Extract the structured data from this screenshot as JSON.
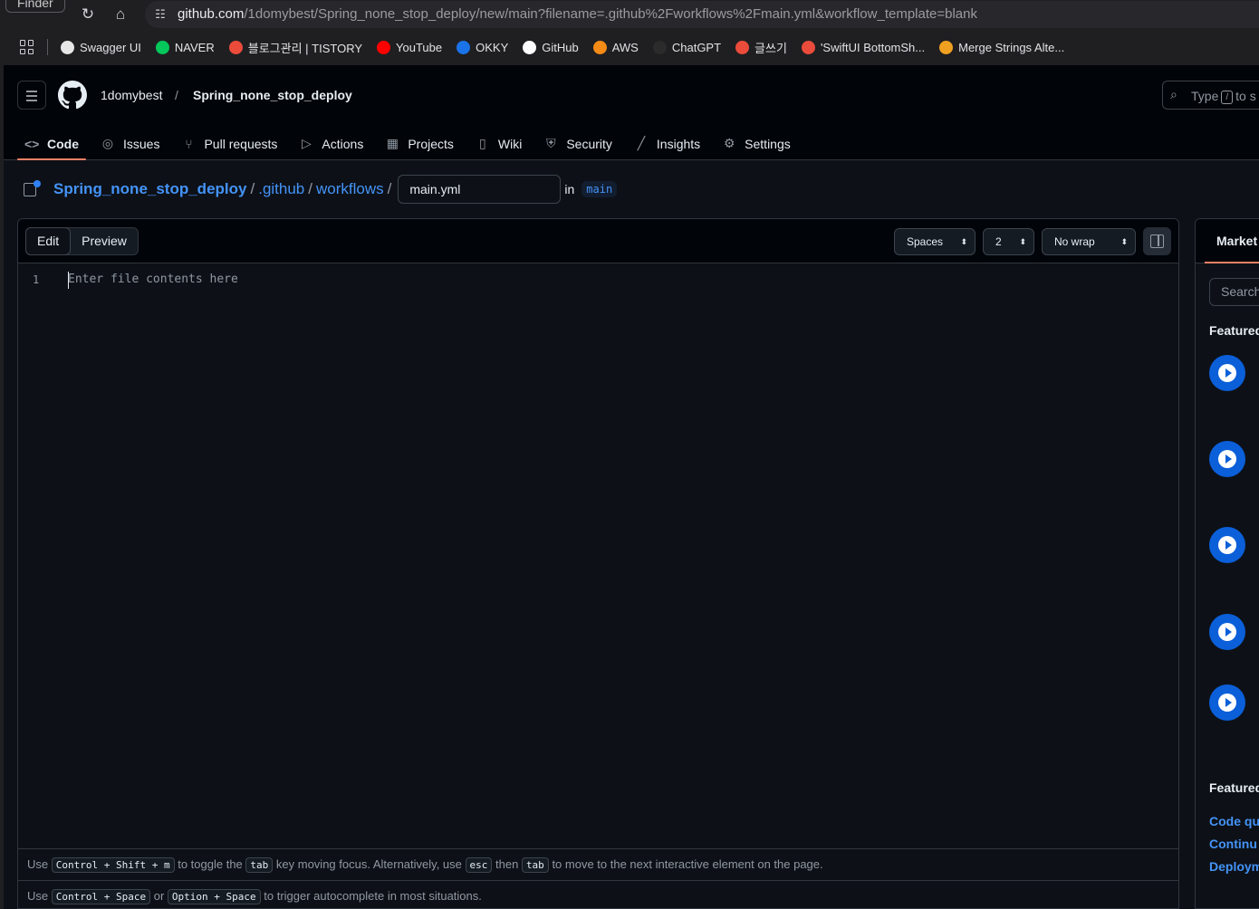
{
  "browser": {
    "finder_label": "Finder",
    "url_host": "github.com",
    "url_path": "/1domybest/Spring_none_stop_deploy/new/main?filename=.github%2Fworkflows%2Fmain.yml&workflow_template=blank",
    "bookmarks": [
      {
        "label": "Swagger UI",
        "color": "#e6e6e6"
      },
      {
        "label": "NAVER",
        "color": "#03c75a"
      },
      {
        "label": "블로그관리 | TISTORY",
        "color": "#eb4b3b"
      },
      {
        "label": "YouTube",
        "color": "#ff0000"
      },
      {
        "label": "OKKY",
        "color": "#1a73e8"
      },
      {
        "label": "GitHub",
        "color": "#ffffff"
      },
      {
        "label": "AWS",
        "color": "#f48b16"
      },
      {
        "label": "ChatGPT",
        "color": "#2b2b2b"
      },
      {
        "label": "글쓰기",
        "color": "#eb4b3b"
      },
      {
        "label": "'SwiftUI BottomSh...",
        "color": "#eb4b3b"
      },
      {
        "label": "Merge Strings Alte...",
        "color": "#f0a020"
      }
    ]
  },
  "header": {
    "owner": "1domybest",
    "separator": "/",
    "repo": "Spring_none_stop_deploy",
    "search_placeholder_pre": "Type",
    "search_key": "/",
    "search_placeholder_post": "to s"
  },
  "tabs": [
    {
      "label": "Code",
      "icon": "code-icon",
      "active": true
    },
    {
      "label": "Issues",
      "icon": "issue-icon"
    },
    {
      "label": "Pull requests",
      "icon": "pull-request-icon"
    },
    {
      "label": "Actions",
      "icon": "play-icon"
    },
    {
      "label": "Projects",
      "icon": "table-icon"
    },
    {
      "label": "Wiki",
      "icon": "book-icon"
    },
    {
      "label": "Security",
      "icon": "shield-icon"
    },
    {
      "label": "Insights",
      "icon": "graph-icon"
    },
    {
      "label": "Settings",
      "icon": "gear-icon"
    }
  ],
  "path": {
    "repo_link": "Spring_none_stop_deploy",
    "dir1": ".github",
    "dir2": "workflows",
    "sep": "/",
    "filename": "main.yml",
    "in_label": "in",
    "branch": "main"
  },
  "editor": {
    "edit_label": "Edit",
    "preview_label": "Preview",
    "indent_mode": "Spaces",
    "indent_size": "2",
    "wrap_mode": "No wrap",
    "line_number": "1",
    "placeholder": "Enter file contents here",
    "hint1": {
      "pre": "Use",
      "k1": "Control + Shift + m",
      "mid1": "to toggle the",
      "k2": "tab",
      "mid2": "key moving focus. Alternatively, use",
      "k3": "esc",
      "mid3": "then",
      "k4": "tab",
      "post": "to move to the next interactive element on the page."
    },
    "hint2": {
      "pre": "Use",
      "k1": "Control + Space",
      "mid": "or",
      "k2": "Option + Space",
      "post": "to trigger autocomplete in most situations."
    }
  },
  "marketplace": {
    "tab_label": "Market",
    "search_placeholder": "Search",
    "featured_heading_1": "Featured",
    "featured_heading_2": "Featured",
    "links": [
      "Code qu",
      "Continu",
      "Deploym"
    ]
  }
}
